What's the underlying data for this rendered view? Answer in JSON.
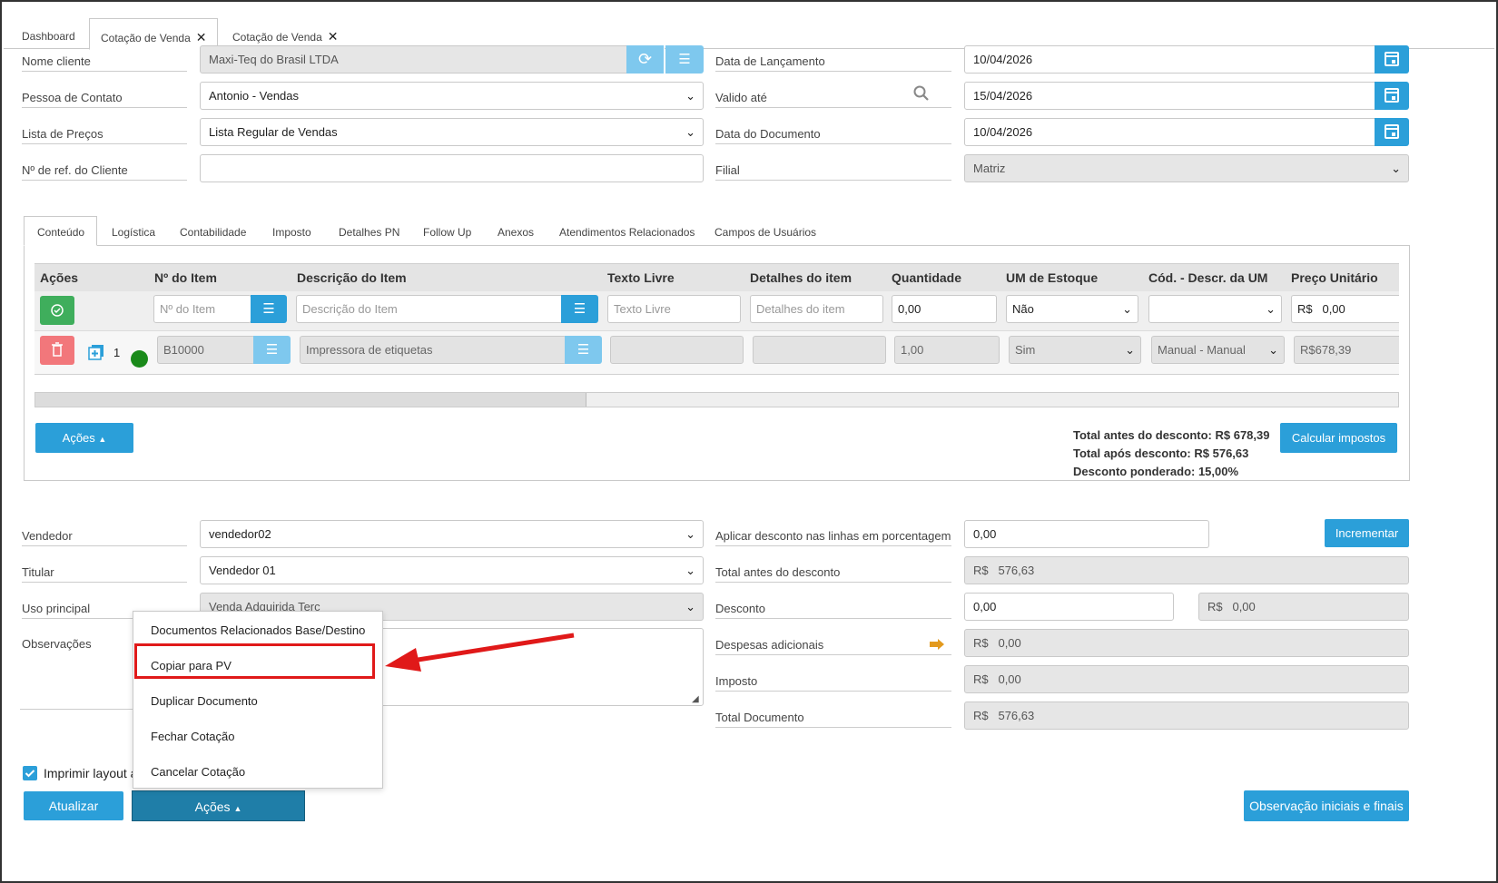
{
  "tabs": [
    {
      "label": "Dashboard"
    },
    {
      "label": "Cotação de Venda",
      "closable": true
    },
    {
      "label": "Cotação de Venda",
      "closable": true
    }
  ],
  "header": {
    "left": [
      {
        "label": "Nome cliente",
        "value": "Maxi-Teq do Brasil LTDA"
      },
      {
        "label": "Pessoa de Contato",
        "value": "Antonio - Vendas"
      },
      {
        "label": "Lista de Preços",
        "value": "Lista Regular de Vendas"
      },
      {
        "label": "Nº de ref. do Cliente",
        "value": ""
      }
    ],
    "right": [
      {
        "label": "Data de Lançamento",
        "value": "10/04/2026"
      },
      {
        "label": "Valido até",
        "value": "15/04/2026"
      },
      {
        "label": "Data do Documento",
        "value": "10/04/2026"
      },
      {
        "label": "Filial",
        "value": "Matriz"
      }
    ]
  },
  "inner_tabs": [
    "Conteúdo",
    "Logística",
    "Contabilidade",
    "Imposto",
    "Detalhes PN",
    "Follow Up",
    "Anexos",
    "Atendimentos Relacionados",
    "Campos de Usuários"
  ],
  "grid": {
    "columns": [
      "Ações",
      "Nº do Item",
      "Descrição do Item",
      "Texto Livre",
      "Detalhes do item",
      "Quantidade",
      "UM de Estoque",
      "Cód. - Descr. da UM",
      "Preço Unitário"
    ],
    "new_row": {
      "item_no_placeholder": "Nº do Item",
      "desc_placeholder": "Descrição do Item",
      "free_text_placeholder": "Texto Livre",
      "details_placeholder": "Detalhes do item",
      "quantity": "0,00",
      "um_estoque": "Não",
      "um_code": "",
      "price_currency": "R$",
      "price": "0,00"
    },
    "rows": [
      {
        "line": "1",
        "item_no": "B10000",
        "description": "Impressora de etiquetas",
        "free_text": "",
        "details": "",
        "quantity": "1,00",
        "um_estoque": "Sim",
        "um_code": "Manual - Manual",
        "price": "R$678,39",
        "status_color": "#1a8a1a"
      }
    ]
  },
  "grid_actions_label": "Ações",
  "calc_taxes_label": "Calcular impostos",
  "totals": [
    "Total antes do desconto: R$ 678,39",
    "Total após desconto: R$ 576,63",
    "Desconto ponderado: 15,00%"
  ],
  "footer": {
    "left": [
      {
        "label": "Vendedor",
        "value": "vendedor02"
      },
      {
        "label": "Titular",
        "value": "Vendedor 01"
      },
      {
        "label": "Uso principal",
        "value": "Venda Adquirida Terc"
      },
      {
        "label": "Observações",
        "value": ""
      }
    ],
    "right": [
      {
        "label": "Aplicar desconto nas linhas em porcentagem",
        "value": "0,00"
      },
      {
        "label": "Total antes do desconto",
        "currency": "R$",
        "value": "576,63"
      },
      {
        "label": "Desconto",
        "value": "0,00",
        "currency": "R$",
        "value2": "0,00"
      },
      {
        "label": "Despesas adicionais",
        "currency": "R$",
        "value": "0,00"
      },
      {
        "label": "Imposto",
        "currency": "R$",
        "value": "0,00"
      },
      {
        "label": "Total Documento",
        "currency": "R$",
        "value": "576,63"
      }
    ],
    "increment_label": "Incrementar",
    "print_layout_label": "Imprimir layout a",
    "print_layout_checked": true,
    "update_label": "Atualizar",
    "actions_label": "Ações",
    "obs_label": "Observação iniciais e finais"
  },
  "actions_menu": [
    "Documentos Relacionados Base/Destino",
    "Copiar para PV",
    "Duplicar Documento",
    "Fechar Cotação",
    "Cancelar Cotação"
  ],
  "colors": {
    "accent": "#2b9fd9",
    "accent_light": "#7ec8ee",
    "dark_button": "#1f7ea8",
    "danger": "#f2777b",
    "success": "#3fae5c",
    "highlight": "#e01919"
  }
}
